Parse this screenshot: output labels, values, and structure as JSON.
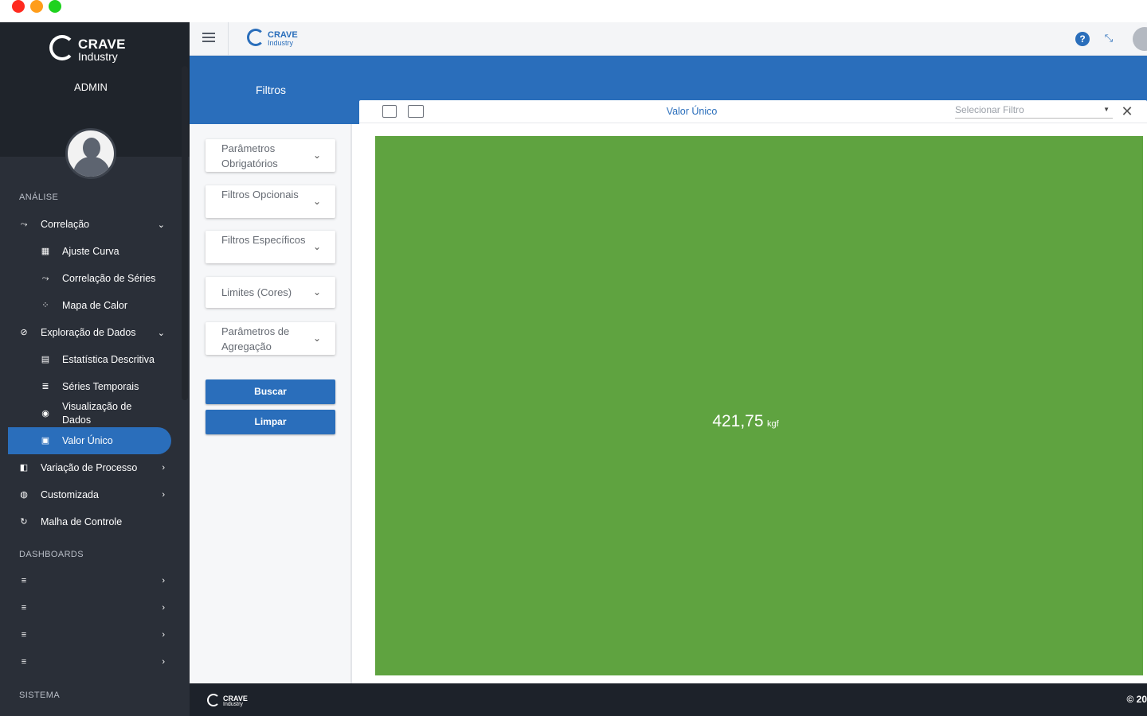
{
  "brand": {
    "name_line1": "CRAVE",
    "name_line2": "Industry",
    "user_role": "ADMIN"
  },
  "sidebar": {
    "sections": {
      "analise": "ANÁLISE",
      "dashboards": "DASHBOARDS",
      "sistema": "SISTEMA"
    },
    "items": [
      {
        "label": "Correlação",
        "icon": "correlation-icon"
      },
      {
        "label": "Ajuste Curva",
        "icon": "grid-icon"
      },
      {
        "label": "Correlação de Séries",
        "icon": "correlation-icon"
      },
      {
        "label": "Mapa de Calor",
        "icon": "heatmap-icon"
      },
      {
        "label": "Exploração de Dados",
        "icon": "compass-icon"
      },
      {
        "label": "Estatística Descritiva",
        "icon": "stats-icon"
      },
      {
        "label": "Séries Temporais",
        "icon": "series-icon"
      },
      {
        "label": "Visualização de Dados",
        "icon": "eye-icon"
      },
      {
        "label": "Valor Único",
        "icon": "single-value-icon"
      },
      {
        "label": "Variação de Processo",
        "icon": "process-icon"
      },
      {
        "label": "Customizada",
        "icon": "palette-icon"
      },
      {
        "label": "Malha de Controle",
        "icon": "loop-icon"
      }
    ]
  },
  "topbar": {
    "logo_line1": "CRAVE",
    "logo_line2": "Industry",
    "help_glyph": "?"
  },
  "filters": {
    "title": "Filtros",
    "accordions": [
      "Parâmetros Obrigatórios",
      "Filtros Opcionais",
      "Filtros Específicos",
      "Limites (Cores)",
      "Parâmetros de Agregação"
    ],
    "search_label": "Buscar",
    "clear_label": "Limpar"
  },
  "card": {
    "title": "Valor Único",
    "select_placeholder": "Selecionar Filtro",
    "value": "421,75",
    "unit": "kgf",
    "value_color": "#5fa340"
  },
  "footer": {
    "logo_line1": "CRAVE",
    "logo_line2": "Industry",
    "copyright": "© 20"
  },
  "colors": {
    "primary": "#2a6ebb",
    "sidebar": "#2a2f38",
    "footer": "#1d222a"
  }
}
